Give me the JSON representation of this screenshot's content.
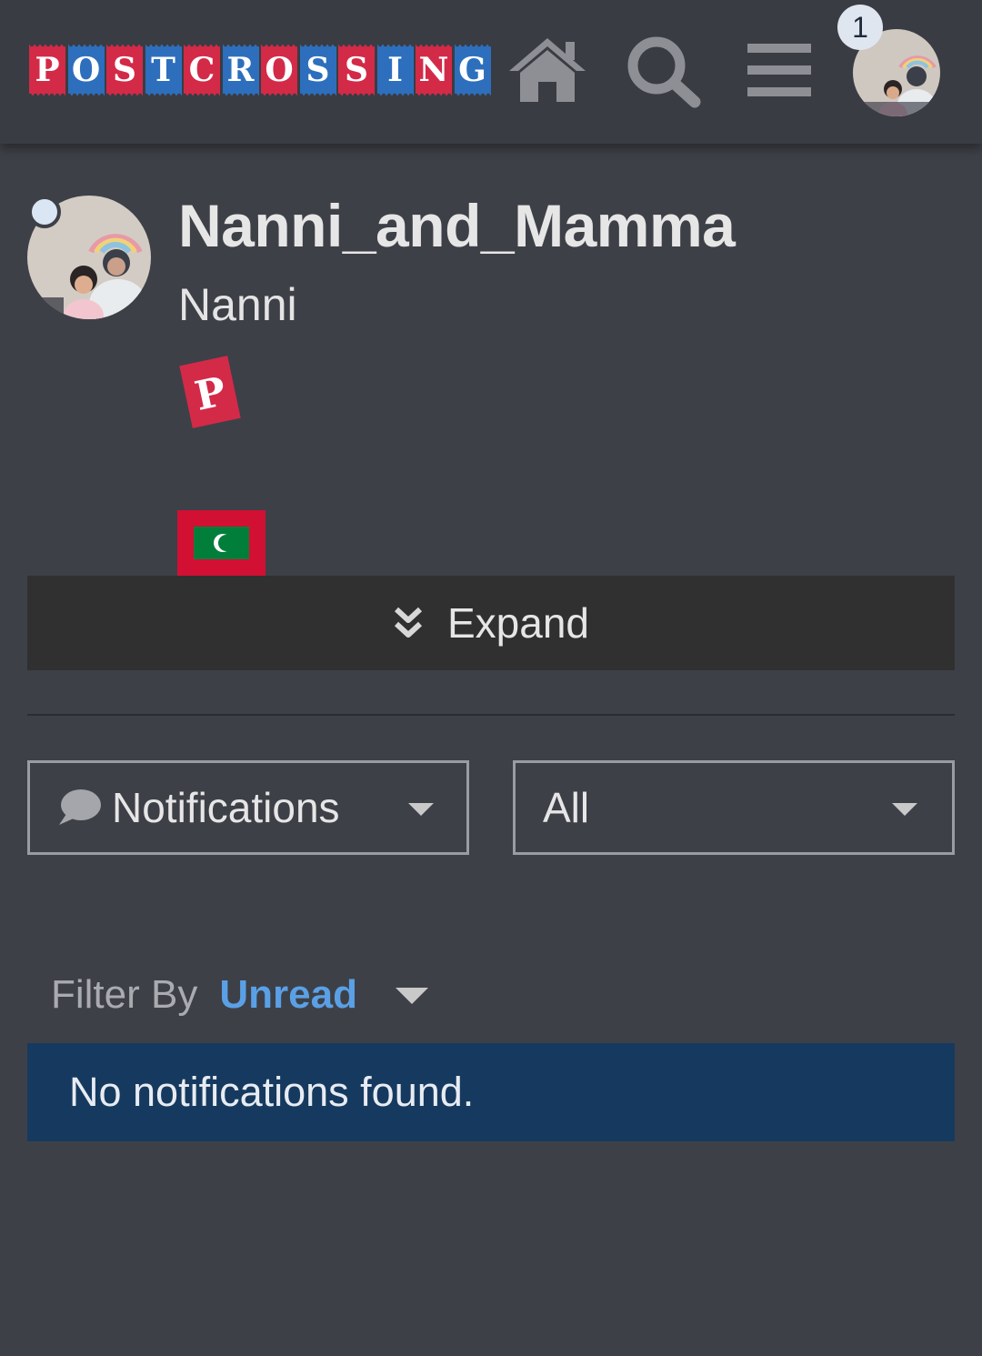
{
  "header": {
    "logo_letters": [
      "P",
      "O",
      "S",
      "T",
      "C",
      "R",
      "O",
      "S",
      "S",
      "I",
      "N",
      "G"
    ],
    "notification_count": "1"
  },
  "profile": {
    "username": "Nanni_and_Mamma",
    "real_name": "Nanni",
    "badge_letter": "P"
  },
  "expand": {
    "label": "Expand"
  },
  "filters": {
    "type_select": "Notifications",
    "scope_select": "All",
    "filter_by_label": "Filter By",
    "filter_by_value": "Unread"
  },
  "empty_state": {
    "message": "No notifications found."
  },
  "colors": {
    "logo_red": "#d32a48",
    "logo_blue": "#2d6fbd",
    "accent_link": "#5aa0e6",
    "info_box": "#163a5f",
    "flag_red": "#d21034",
    "flag_green": "#007e3a"
  }
}
